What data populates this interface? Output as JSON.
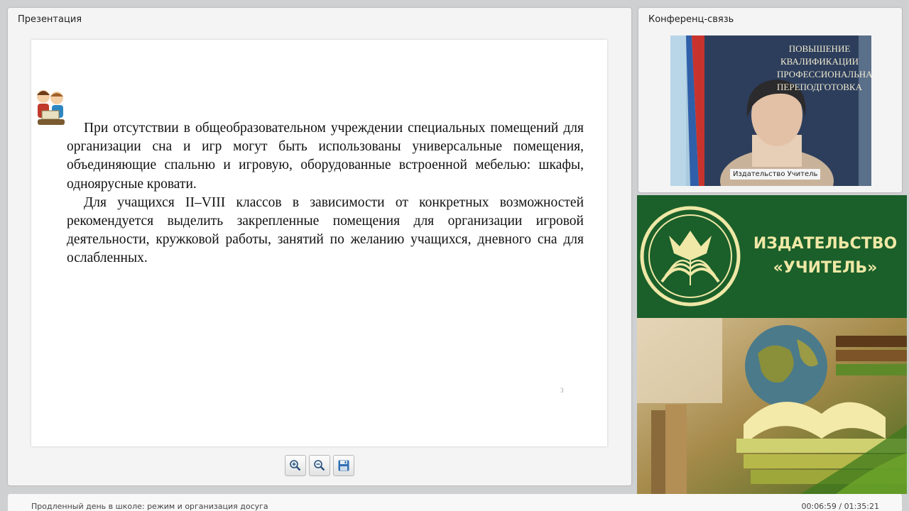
{
  "presentation": {
    "title": "Презентация",
    "slide": {
      "paragraphs": [
        "При отсутствии в общеобразовательном учреждении специальных помещений для организации сна и игр могут быть использованы универсальные помещения, объединяющие спальню и игровую, оборудованные встроенной мебелью: шкафы, одноярусные кровати.",
        "Для учащихся II–VIII классов в зависимости от конкретных возможностей рекомендуется выделить закрепленные помещения для организации игровой деятельности, кружковой работы, занятий по желанию учащихся, дневного сна для ослабленных."
      ],
      "page_number": "3"
    },
    "toolbar": {
      "icons": [
        "zoom-in-icon",
        "zoom-out-icon",
        "save-icon"
      ]
    }
  },
  "conference": {
    "title": "Конференц-связь",
    "participant_name": "Издательство Учитель",
    "backdrop_text": [
      "ПОВЫШЕНИЕ",
      "КВАЛИФИКАЦИИ",
      "ПРОФЕССИОНАЛЬНАЯ",
      "ПЕРЕПОДГОТОВКА"
    ]
  },
  "publisher": {
    "name_line1": "ИЗДАТЕЛЬСТВО",
    "name_line2": "«УЧИТЕЛЬ»",
    "brand_color": "#1b5f2a",
    "accent_color": "#efe8a6"
  },
  "footer": {
    "webinar_title": "Продленный день в школе: режим и организация досуга",
    "time": "00:06:59 / 01:35:21"
  }
}
